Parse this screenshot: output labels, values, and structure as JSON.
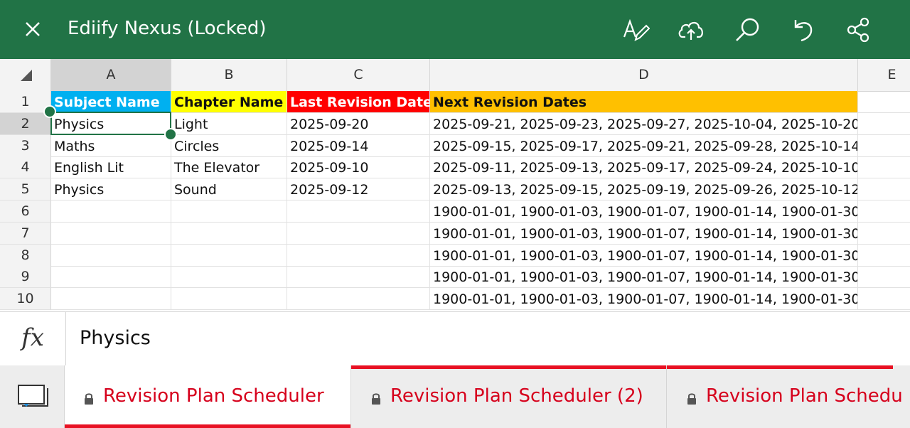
{
  "app": {
    "title": "Ediify Nexus (Locked)",
    "accent": "#217346",
    "icons": [
      "close-icon",
      "pen-icon",
      "cloud-upload-icon",
      "search-icon",
      "undo-icon",
      "share-icon"
    ]
  },
  "sheet": {
    "columns": [
      "A",
      "B",
      "C",
      "D",
      "E"
    ],
    "selected_column": "A",
    "selected_row": "2",
    "header_colors": [
      "#00b0f0",
      "#ffff00",
      "#ff0000",
      "#ffc000"
    ],
    "rows": [
      {
        "num": "1",
        "cells": [
          "Subject Name",
          "Chapter Name",
          "Last Revision Date",
          "Next Revision Dates",
          ""
        ]
      },
      {
        "num": "2",
        "cells": [
          "Physics",
          "Light",
          "2025-09-20",
          "2025-09-21, 2025-09-23, 2025-09-27, 2025-10-04, 2025-10-20",
          ""
        ]
      },
      {
        "num": "3",
        "cells": [
          "Maths",
          "Circles",
          "2025-09-14",
          "2025-09-15, 2025-09-17, 2025-09-21, 2025-09-28, 2025-10-14",
          ""
        ]
      },
      {
        "num": "4",
        "cells": [
          "English Lit",
          "The Elevator",
          "2025-09-10",
          "2025-09-11, 2025-09-13, 2025-09-17, 2025-09-24, 2025-10-10",
          ""
        ]
      },
      {
        "num": "5",
        "cells": [
          "Physics",
          "Sound",
          "2025-09-12",
          "2025-09-13, 2025-09-15, 2025-09-19, 2025-09-26, 2025-10-12",
          ""
        ]
      },
      {
        "num": "6",
        "cells": [
          "",
          "",
          "",
          "1900-01-01, 1900-01-03, 1900-01-07, 1900-01-14, 1900-01-30",
          ""
        ]
      },
      {
        "num": "7",
        "cells": [
          "",
          "",
          "",
          "1900-01-01, 1900-01-03, 1900-01-07, 1900-01-14, 1900-01-30",
          ""
        ]
      },
      {
        "num": "8",
        "cells": [
          "",
          "",
          "",
          "1900-01-01, 1900-01-03, 1900-01-07, 1900-01-14, 1900-01-30",
          ""
        ]
      },
      {
        "num": "9",
        "cells": [
          "",
          "",
          "",
          "1900-01-01, 1900-01-03, 1900-01-07, 1900-01-14, 1900-01-30",
          ""
        ]
      },
      {
        "num": "10",
        "cells": [
          "",
          "",
          "",
          "1900-01-01, 1900-01-03, 1900-01-07, 1900-01-14, 1900-01-30",
          ""
        ]
      }
    ]
  },
  "formula_bar": {
    "fx_label": "fx",
    "value": "Physics"
  },
  "tabs": [
    {
      "label": "Revision Plan Scheduler",
      "active": true
    },
    {
      "label": "Revision Plan Scheduler (2)",
      "active": false
    },
    {
      "label": "Revision Plan Schedu",
      "active": false
    }
  ]
}
